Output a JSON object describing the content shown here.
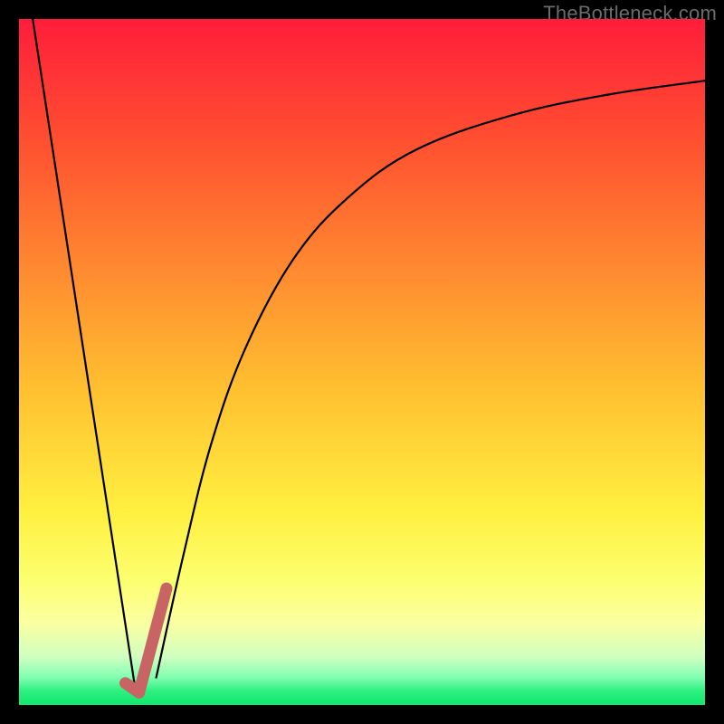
{
  "watermark": "TheBottleneck.com",
  "chart_data": {
    "type": "line",
    "title": "",
    "xlabel": "",
    "ylabel": "",
    "xlim": [
      0,
      100
    ],
    "ylim": [
      0,
      100
    ],
    "grid": false,
    "series": [
      {
        "name": "left-descending-line",
        "color": "#000000",
        "width": 2.2,
        "x": [
          2,
          17
        ],
        "y": [
          100,
          2
        ]
      },
      {
        "name": "right-ascending-curve",
        "color": "#000000",
        "width": 2.2,
        "x": [
          20,
          24,
          28,
          33,
          40,
          48,
          58,
          72,
          86,
          100
        ],
        "y": [
          4,
          22,
          38,
          52,
          65,
          74,
          81,
          86,
          89,
          91
        ]
      },
      {
        "name": "hook-marker",
        "color": "#c86464",
        "width": 13,
        "x": [
          15.5,
          17.5,
          21.5
        ],
        "y": [
          3.2,
          1.8,
          17
        ]
      }
    ]
  }
}
